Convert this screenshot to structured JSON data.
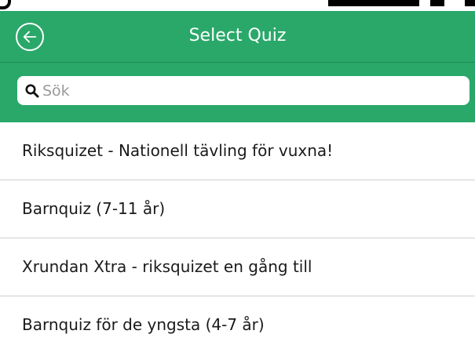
{
  "header": {
    "title": "Select Quiz",
    "back_icon": "arrow-left-circle-icon"
  },
  "search": {
    "placeholder": "Sök",
    "value": "",
    "icon": "search-icon"
  },
  "quizzes": [
    {
      "label": "Riksquizet - Nationell tävling för vuxna!"
    },
    {
      "label": "Barnquiz (7-11 år)"
    },
    {
      "label": "Xrundan Xtra - riksquizet en gång till"
    },
    {
      "label": "Barnquiz för de yngsta (4-7 år)"
    }
  ],
  "colors": {
    "brand_green": "#2aa86a",
    "text": "#1a1a1a",
    "divider": "#cfcfcf",
    "placeholder": "#9a9a9a"
  }
}
